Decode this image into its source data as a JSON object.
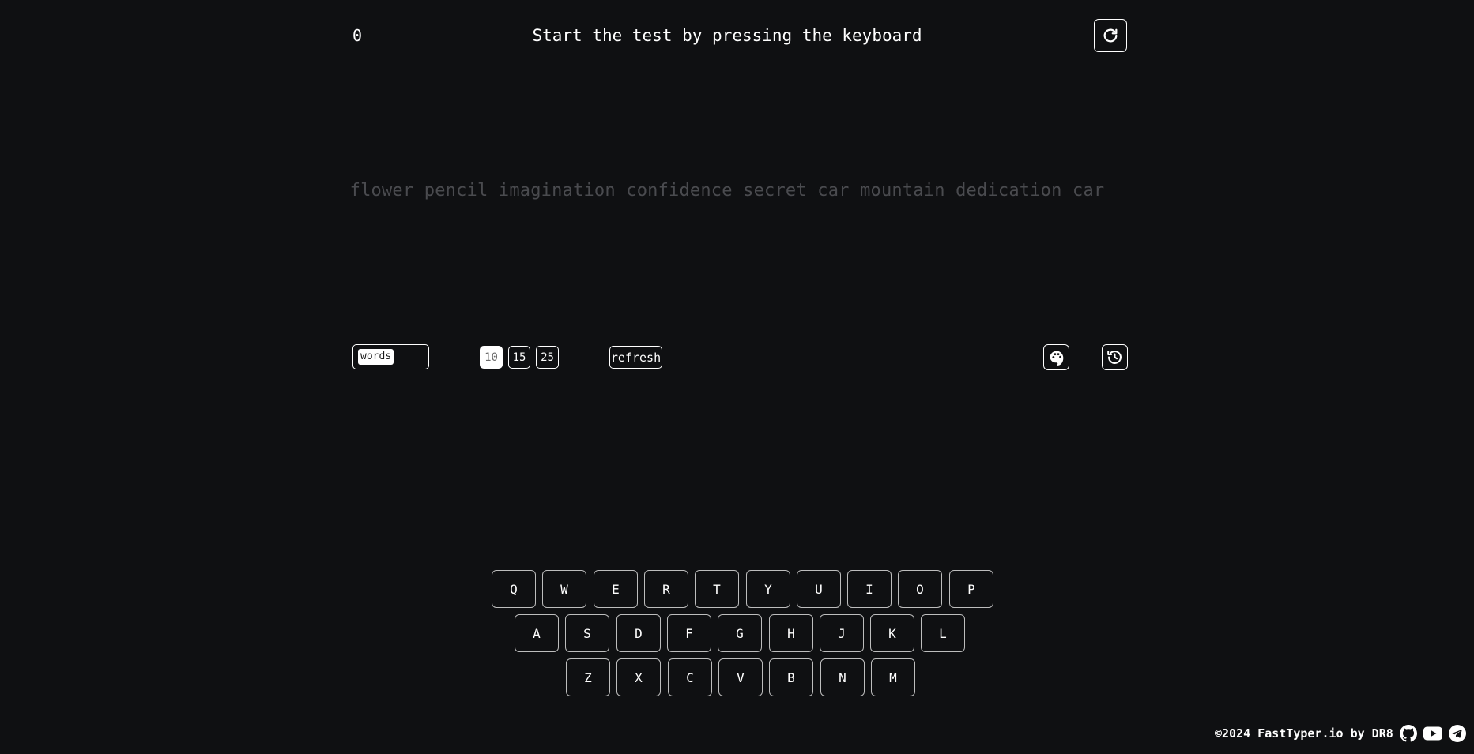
{
  "header": {
    "counter": "0",
    "status": "Start the test by pressing the keyboard",
    "restart_icon": "restart-icon"
  },
  "words": [
    "flower",
    "pencil",
    "imagination",
    "confidence",
    "secret",
    "car",
    "mountain",
    "dedication",
    "car"
  ],
  "controls": {
    "mode": "words",
    "counts": [
      "10",
      "15",
      "25"
    ],
    "active_count": "10",
    "refresh_label": "refresh",
    "theme_icon": "palette-icon",
    "history_icon": "history-icon"
  },
  "keyboard": {
    "row1": [
      "Q",
      "W",
      "E",
      "R",
      "T",
      "Y",
      "U",
      "I",
      "O",
      "P"
    ],
    "row2": [
      "A",
      "S",
      "D",
      "F",
      "G",
      "H",
      "J",
      "K",
      "L"
    ],
    "row3": [
      "Z",
      "X",
      "C",
      "V",
      "B",
      "N",
      "M"
    ]
  },
  "footer": {
    "text": "©2024 FastTyper.io by DR8",
    "icons": [
      "github-icon",
      "youtube-icon",
      "telegram-icon"
    ]
  },
  "colors": {
    "background": "#0f1012",
    "foreground": "#ffffff",
    "untyped_word": "#4a4b4f",
    "key_border": "#bdbdbd"
  }
}
